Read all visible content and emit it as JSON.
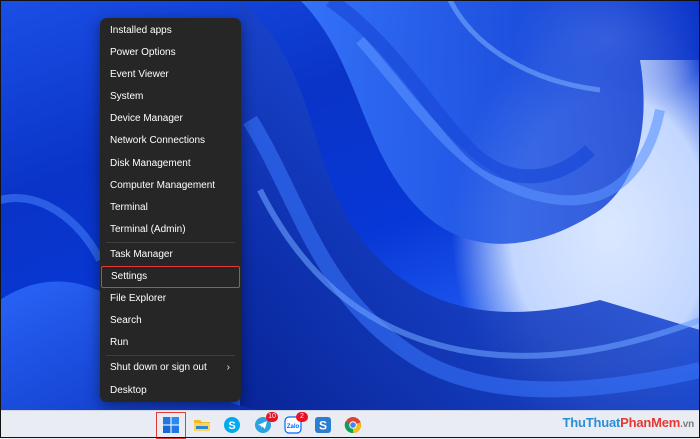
{
  "context_menu": {
    "items": [
      {
        "label": "Installed apps"
      },
      {
        "label": "Power Options"
      },
      {
        "label": "Event Viewer"
      },
      {
        "label": "System"
      },
      {
        "label": "Device Manager"
      },
      {
        "label": "Network Connections"
      },
      {
        "label": "Disk Management"
      },
      {
        "label": "Computer Management"
      },
      {
        "label": "Terminal"
      },
      {
        "label": "Terminal (Admin)"
      },
      {
        "label": "Task Manager"
      },
      {
        "label": "Settings"
      },
      {
        "label": "File Explorer"
      },
      {
        "label": "Search"
      },
      {
        "label": "Run"
      },
      {
        "label": "Shut down or sign out",
        "submenu_icon": "chevron-right-icon"
      },
      {
        "label": "Desktop"
      }
    ],
    "highlighted_item": "Settings"
  },
  "taskbar": {
    "icons": [
      {
        "name": "windows-start-icon",
        "highlighted": true
      },
      {
        "name": "file-explorer-icon"
      },
      {
        "name": "skype-icon",
        "glyph": "S"
      },
      {
        "name": "telegram-icon",
        "badge": "10"
      },
      {
        "name": "zalo-icon",
        "glyph": "Zalo",
        "badge": "2"
      },
      {
        "name": "snagit-icon",
        "glyph": "S"
      },
      {
        "name": "chrome-icon"
      }
    ]
  },
  "watermark": {
    "part1": "Thu",
    "part2": "Thuat",
    "part3": "PhanMem",
    "part4": ".vn"
  },
  "colors": {
    "menu_bg": "#262626",
    "highlight": "#e53935",
    "taskbar_bg": "#e9edf3",
    "wallpaper": "#0a34c7"
  }
}
